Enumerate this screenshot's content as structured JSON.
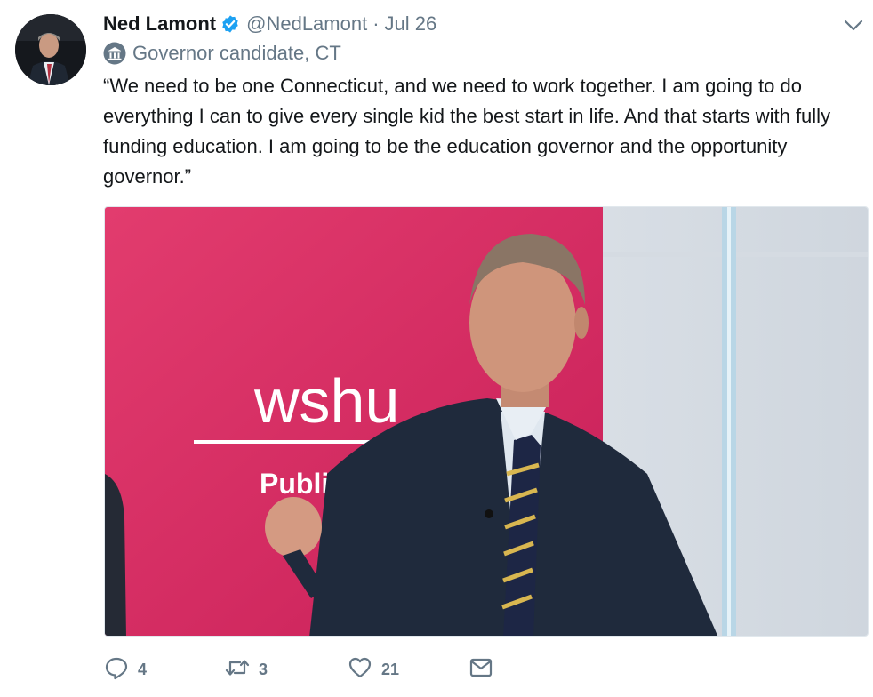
{
  "tweet": {
    "author_name": "Ned Lamont",
    "handle": "@NedLamont",
    "separator": "·",
    "date": "Jul 26",
    "label": "Governor candidate, CT",
    "text": "“We need to be one Connecticut, and we need to work together. I am going to do everything I can to give every single kid the best start in life. And that starts with fully funding education. I am going to be the education governor and the opportunity governor.”"
  },
  "media": {
    "banner_brand": "wshu",
    "banner_subtitle": "Public Ra"
  },
  "actions": {
    "reply_count": "4",
    "retweet_count": "3",
    "like_count": "21"
  },
  "icons": {
    "verified": "verified-badge-icon",
    "label": "government-building-icon",
    "menu": "chevron-down-icon",
    "reply": "reply-icon",
    "retweet": "retweet-icon",
    "like": "heart-icon",
    "dm": "envelope-icon"
  },
  "colors": {
    "text": "#14171a",
    "secondary": "#657786",
    "verified": "#1da1f2",
    "banner": "#d9265f"
  }
}
